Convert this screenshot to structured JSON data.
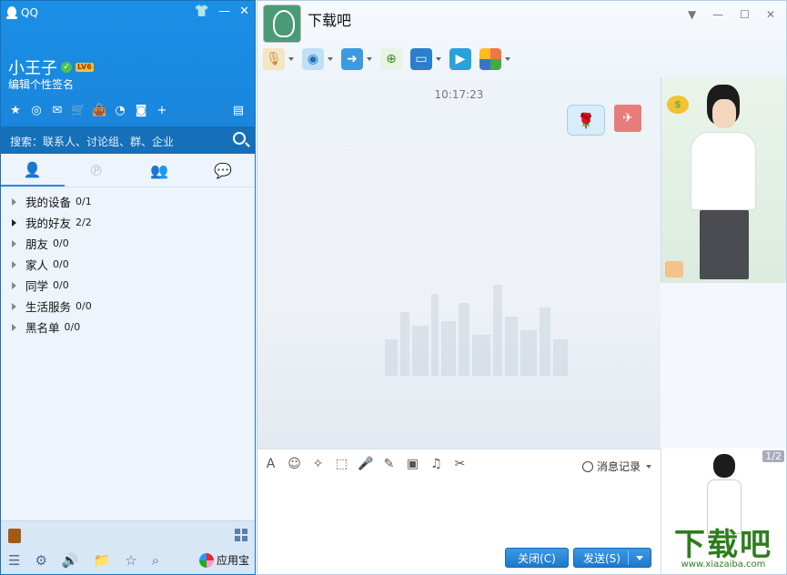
{
  "qq_panel": {
    "app_title": "QQ",
    "window_controls": {
      "skin": "shirt-icon",
      "minimize": "minimize-icon",
      "close": "close-icon"
    },
    "nickname": "小王子",
    "level_badge": "LV6",
    "signature": "编辑个性签名",
    "app_icons": [
      "star-icon",
      "search-icon",
      "mail-icon",
      "cart-icon",
      "wallet-icon",
      "music-icon",
      "camera-icon",
      "plus-icon"
    ],
    "search_placeholder": "搜索：联系人、讨论组、群、企业",
    "tabs": [
      "contacts-icon",
      "moments-icon",
      "groups-icon",
      "sessions-icon"
    ],
    "groups": [
      {
        "name": "我的设备",
        "count": "0/1"
      },
      {
        "name": "我的好友",
        "count": "2/2"
      },
      {
        "name": "朋友",
        "count": "0/0"
      },
      {
        "name": "家人",
        "count": "0/0"
      },
      {
        "name": "同学",
        "count": "0/0"
      },
      {
        "name": "生活服务",
        "count": "0/0"
      },
      {
        "name": "黑名单",
        "count": "0/0"
      }
    ],
    "footer": {
      "icons": [
        "menu-icon",
        "settings-icon",
        "volume-icon",
        "folder-icon",
        "favorite-icon",
        "search-icon"
      ],
      "app_store_label": "应用宝"
    }
  },
  "chat": {
    "title": "下载吧",
    "timestamp": "10:17:23",
    "toolbar": [
      "mic-icon",
      "camera-icon",
      "file-transfer-icon",
      "create-group-icon",
      "remote-desktop-icon",
      "screen-share-icon",
      "apps-icon"
    ],
    "input_tools": [
      "font-icon",
      "emoji-icon",
      "poke-icon",
      "screenshot-icon",
      "voice-icon",
      "edit-icon",
      "image-icon",
      "music-icon",
      "scissors-icon"
    ],
    "history_label": "消息记录",
    "close_button": "关闭(C)",
    "send_button": "发送(S)",
    "pager": "1/2",
    "brand_text": "下载吧",
    "brand_url": "www.xiazaiba.com"
  },
  "colors": {
    "qq_blue": "#1b8fe6",
    "button_blue": "#1d79cc",
    "brand_green": "#2e7d1e"
  }
}
